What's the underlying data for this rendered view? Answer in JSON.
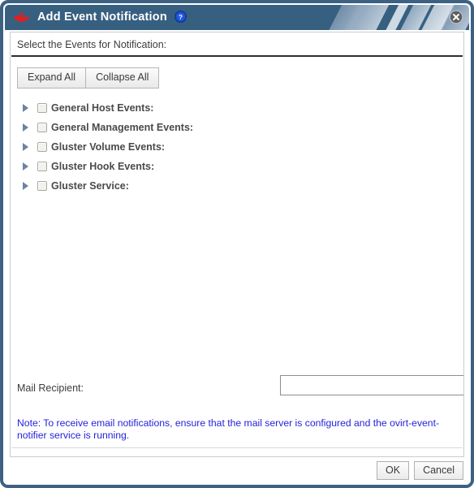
{
  "window": {
    "title": "Add Event Notification",
    "logo_icon": "redhat-shadowman-icon",
    "help_icon": "help-question-icon",
    "close_icon": "close-icon",
    "title_bar_color": "#375f80",
    "frame_color": "#3d6183"
  },
  "content": {
    "section_label": "Select the Events for Notification:",
    "toolbar": {
      "expand_all_label": "Expand All",
      "collapse_all_label": "Collapse All"
    },
    "tree_items": [
      {
        "label": "General Host Events:",
        "expanded": false,
        "checked": false
      },
      {
        "label": "General Management Events:",
        "expanded": false,
        "checked": false
      },
      {
        "label": "Gluster Volume Events:",
        "expanded": false,
        "checked": false
      },
      {
        "label": "Gluster Hook Events:",
        "expanded": false,
        "checked": false
      },
      {
        "label": "Gluster Service:",
        "expanded": false,
        "checked": false
      }
    ]
  },
  "mail": {
    "recipient_label": "Mail Recipient:",
    "recipient_value": "",
    "recipient_placeholder": "",
    "note": "Note: To receive email notifications, ensure that the mail server is configured and the ovirt-event-notifier service is running.",
    "note_color": "#2323dc"
  },
  "footer": {
    "ok_label": "OK",
    "cancel_label": "Cancel"
  }
}
